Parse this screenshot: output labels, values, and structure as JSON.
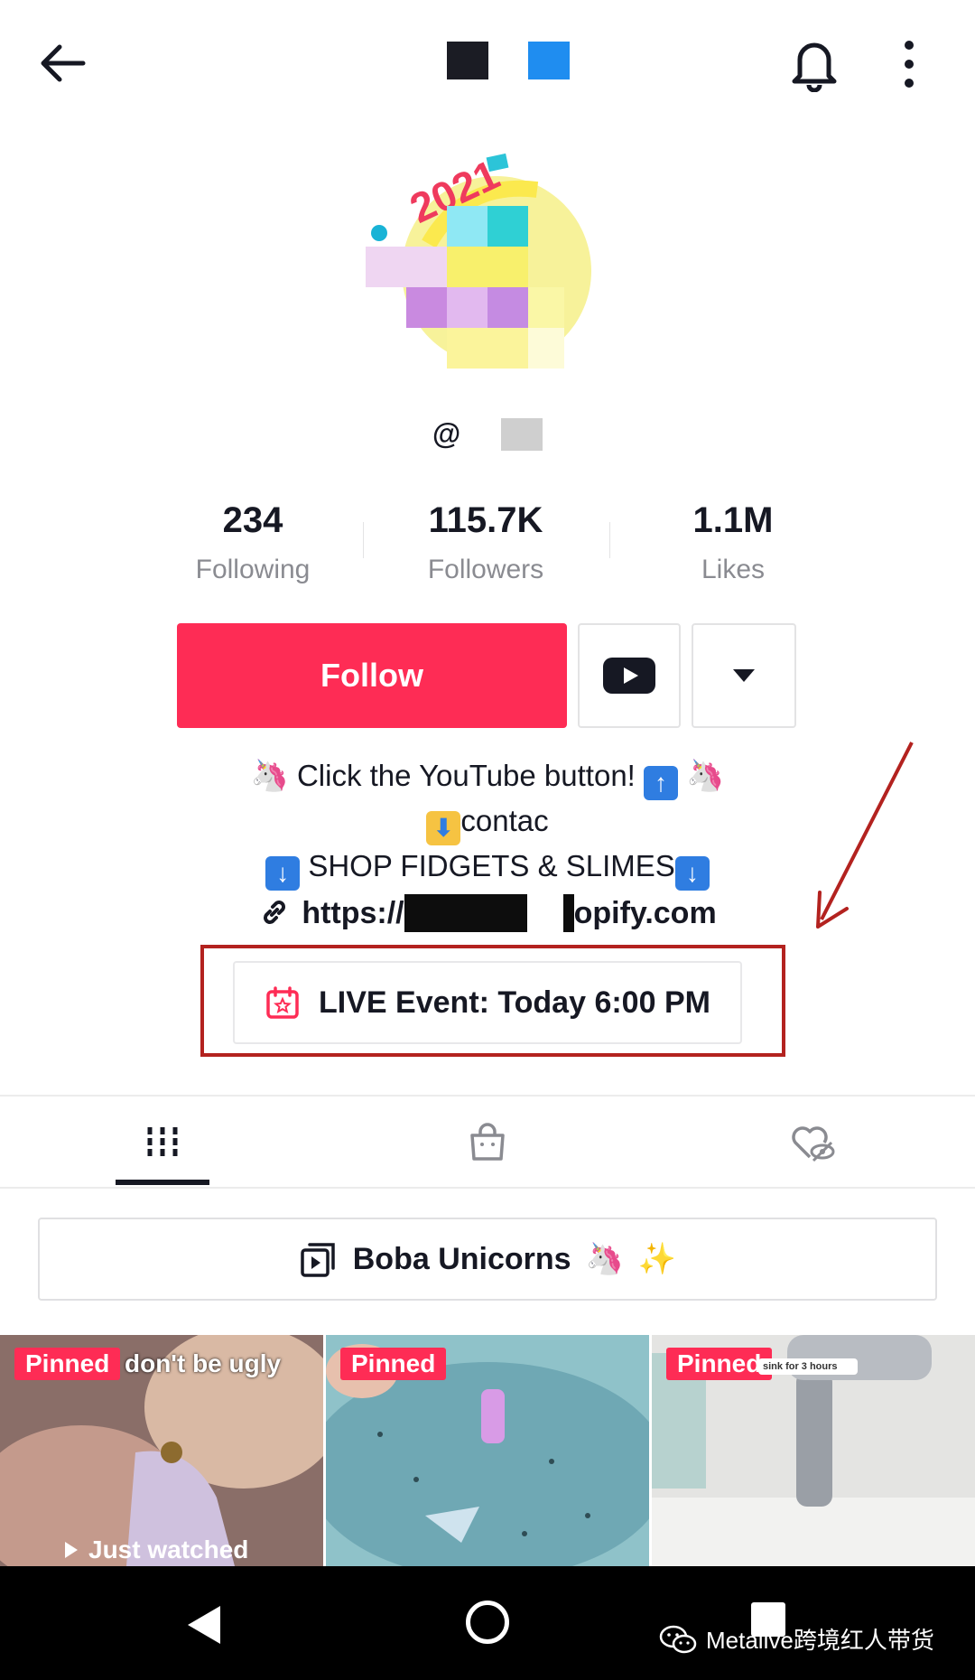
{
  "profile": {
    "handle_prefix": "@",
    "stats": [
      {
        "value": "234",
        "label": "Following"
      },
      {
        "value": "115.7K",
        "label": "Followers"
      },
      {
        "value": "1.1M",
        "label": "Likes"
      }
    ],
    "follow_label": "Follow",
    "bio": {
      "line1": "Click the YouTube button!",
      "line2": "contac",
      "line3": "SHOP FIDGETS & SLIMES"
    },
    "link": {
      "prefix": "https://",
      "suffix": "opify.com"
    },
    "live_event": "LIVE Event: Today 6:00 PM"
  },
  "tabs": [
    {
      "name": "videos",
      "icon": "grid-icon",
      "active": true
    },
    {
      "name": "shop",
      "icon": "shopping-bag-icon",
      "active": false
    },
    {
      "name": "liked",
      "icon": "hidden-likes-icon",
      "active": false
    }
  ],
  "playlist": {
    "label": "Boba Unicorns"
  },
  "videos": [
    {
      "badge": "Pinned",
      "caption": "don't be ugly",
      "overlay": "Just watched"
    },
    {
      "badge": "Pinned"
    },
    {
      "badge": "Pinned",
      "note": "sink for 3 hours"
    }
  ],
  "watermark": "Metalive跨境红人带货",
  "colors": {
    "accent": "#fe2c55",
    "annotation": "#b3221f"
  }
}
